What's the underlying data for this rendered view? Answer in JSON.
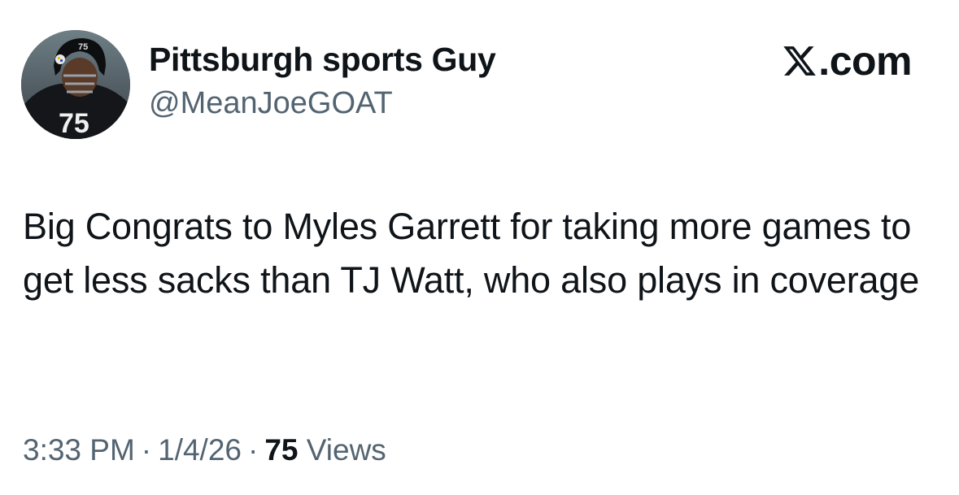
{
  "author": {
    "display_name": "Pittsburgh sports Guy",
    "handle": "@MeanJoeGOAT",
    "avatar_jersey_number": "75"
  },
  "watermark": {
    "logo_icon": "x-logo-icon",
    "text": ".com"
  },
  "tweet": {
    "text": "Big Congrats to Myles Garrett for taking more games to get less sacks than TJ Watt, who also plays in coverage"
  },
  "meta": {
    "time": "3:33 PM",
    "separator": "·",
    "date": "1/4/26",
    "views_count": "75",
    "views_label": "Views"
  },
  "colors": {
    "text_primary": "#0f1419",
    "text_secondary": "#536471",
    "background": "#ffffff"
  }
}
